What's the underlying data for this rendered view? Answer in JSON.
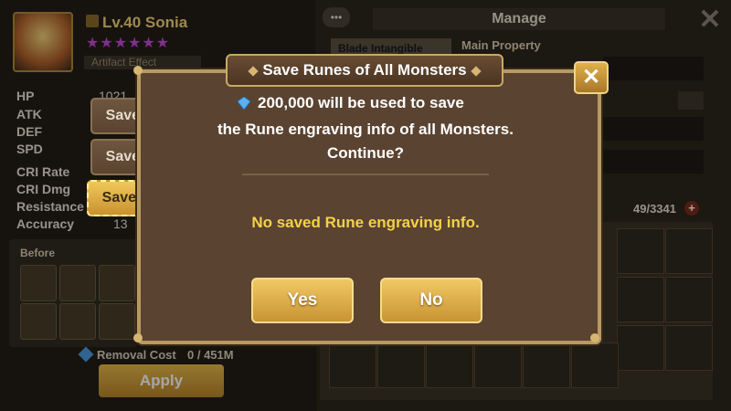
{
  "monster": {
    "level_name": "Lv.40 Sonia",
    "stars": "★★★★★★",
    "artifact_label": "Artifact Effect"
  },
  "stats": [
    {
      "label": "HP",
      "value": "1021"
    },
    {
      "label": "ATK",
      "value": ""
    },
    {
      "label": "DEF",
      "value": ""
    },
    {
      "label": "SPD",
      "value": ""
    },
    {
      "label": "CRI Rate",
      "value": ""
    },
    {
      "label": "CRI Dmg",
      "value": ""
    },
    {
      "label": "Resistance",
      "value": ""
    },
    {
      "label": "Accuracy",
      "value": "13"
    }
  ],
  "before_label": "Before",
  "removal": {
    "label": "Removal Cost",
    "value": "0 / 451M"
  },
  "apply_label": "Apply",
  "manage_title": "Manage",
  "main_property_label": "Main Property",
  "set_label": "Blade Intangible",
  "rune_count": "49/3341",
  "dialog": {
    "title": "Save Runes of All Monsters",
    "line1": "200,000 will be used to save",
    "line2": "the Rune engraving info of all Monsters.",
    "line3": "Continue?",
    "status": "No saved Rune engraving info.",
    "yes_label": "Yes",
    "no_label": "No",
    "close_label": "✕"
  },
  "save_slots": [
    {
      "label": "Save 1",
      "selected": false
    },
    {
      "label": "Save 2",
      "selected": false
    },
    {
      "label": "Save 3",
      "selected": true
    }
  ],
  "colors": {
    "accent_gold": "#f0c964",
    "status_yellow": "#f2d24a",
    "dialog_bg": "#5a4330"
  }
}
